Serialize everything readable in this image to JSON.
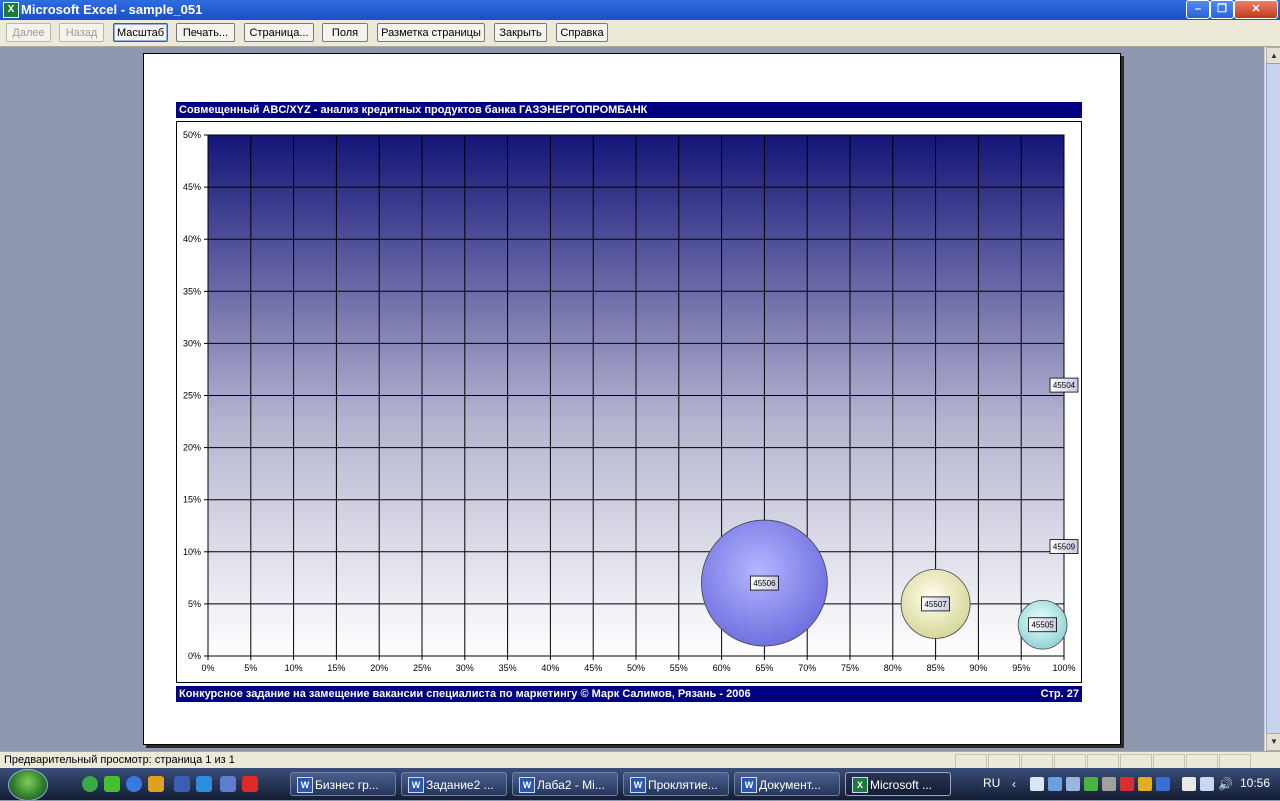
{
  "window": {
    "title": "Microsoft Excel - sample_051",
    "app_icon": "X"
  },
  "toolbar": {
    "buttons": [
      {
        "label": "Далее",
        "enabled": false
      },
      {
        "label": "Назад",
        "enabled": false
      },
      {
        "label": "Масштаб",
        "enabled": true,
        "active": true
      },
      {
        "label": "Печать...",
        "enabled": true
      },
      {
        "label": "Страница...",
        "enabled": true
      },
      {
        "label": "Поля",
        "enabled": true
      },
      {
        "label": "Разметка страницы",
        "enabled": true
      },
      {
        "label": "Закрыть",
        "enabled": true
      },
      {
        "label": "Справка",
        "enabled": true
      }
    ]
  },
  "report": {
    "title": "Совмещенный ABC/XYZ - анализ кредитных продуктов банка ГАЗЭНЕРГОПРОМБАНК",
    "footer": "Конкурсное задание на замещение вакансии специалиста по маркетингу © Марк Салимов, Рязань - 2006",
    "page_label": "Стр. 27"
  },
  "chart_data": {
    "type": "scatter",
    "subtype": "bubble",
    "title": "",
    "xlabel": "",
    "ylabel": "",
    "xlim": [
      0,
      100
    ],
    "ylim": [
      0,
      50
    ],
    "x_ticks": [
      "0%",
      "5%",
      "10%",
      "15%",
      "20%",
      "25%",
      "30%",
      "35%",
      "40%",
      "45%",
      "50%",
      "55%",
      "60%",
      "65%",
      "70%",
      "75%",
      "80%",
      "85%",
      "90%",
      "95%",
      "100%"
    ],
    "y_ticks": [
      "0%",
      "5%",
      "10%",
      "15%",
      "20%",
      "25%",
      "30%",
      "35%",
      "40%",
      "45%",
      "50%"
    ],
    "grid": true,
    "legend": "none",
    "points": [
      {
        "label": "45506",
        "x": 65,
        "y": 7,
        "size": 100,
        "color": "#7f7ff0"
      },
      {
        "label": "45507",
        "x": 85,
        "y": 5,
        "size": 30,
        "color": "#ecebb8"
      },
      {
        "label": "45505",
        "x": 97.5,
        "y": 3,
        "size": 15,
        "color": "#a8e4e4"
      },
      {
        "label": "45509",
        "x": 100,
        "y": 10.5,
        "size": 0,
        "color": "#ffffff"
      },
      {
        "label": "45504",
        "x": 100,
        "y": 26,
        "size": 0,
        "color": "#ffffff"
      }
    ]
  },
  "status": {
    "text": "Предварительный просмотр: страница 1 из 1"
  },
  "taskbar": {
    "tasks": [
      {
        "label": "Бизнес гр...",
        "icon": "W",
        "active": false
      },
      {
        "label": "Задание2 ...",
        "icon": "W",
        "active": false
      },
      {
        "label": "Лаба2 - Mi...",
        "icon": "W",
        "active": false
      },
      {
        "label": "Проклятие...",
        "icon": "W",
        "active": false
      },
      {
        "label": "Документ...",
        "icon": "W",
        "active": false
      },
      {
        "label": "Microsoft ...",
        "icon": "X",
        "active": true
      }
    ],
    "language": "RU",
    "clock": "10:56"
  }
}
